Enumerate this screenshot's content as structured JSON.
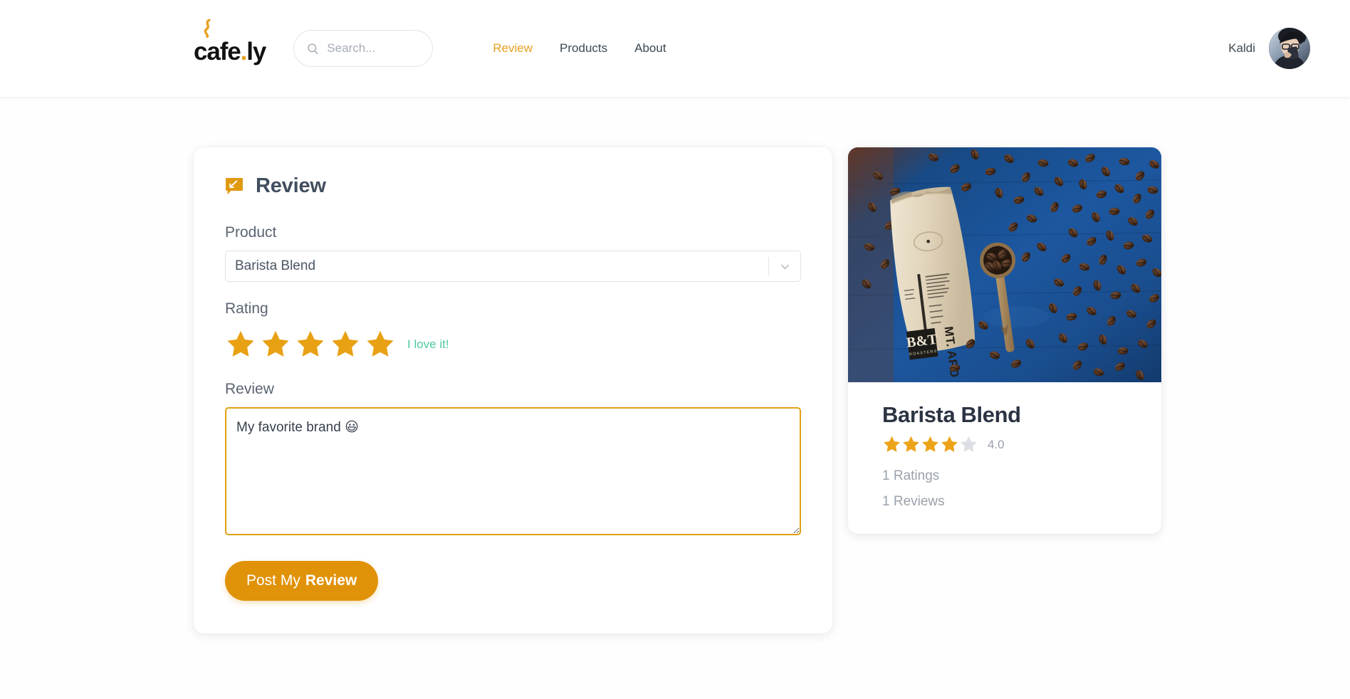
{
  "header": {
    "logo_text": "cafe",
    "logo_dot": ".",
    "logo_suffix": "ly",
    "logo_icon": "coffee-steam-swirl",
    "search": {
      "placeholder": "Search...",
      "value": "",
      "icon": "search-icon"
    },
    "nav": [
      {
        "label": "Review",
        "active": true
      },
      {
        "label": "Products",
        "active": false
      },
      {
        "label": "About",
        "active": false
      }
    ],
    "user": {
      "name": "Kaldi",
      "avatar_alt": "user-avatar-photo"
    }
  },
  "review_form": {
    "icon": "review-bubble-edit-icon",
    "title": "Review",
    "product": {
      "label": "Product",
      "selected": "Barista Blend",
      "options": [
        "Barista Blend"
      ],
      "arrow_icon": "chevron-down-icon"
    },
    "rating": {
      "label": "Rating",
      "value": 5,
      "max": 5,
      "caption": "I love it!",
      "caption_color": "#4dc99c",
      "star_color": "#e8a113"
    },
    "review": {
      "label": "Review",
      "value": "My favorite brand 😃",
      "placeholder": "",
      "focused": true,
      "border_color": "#e0a013"
    },
    "submit": {
      "label_regular": "Post My",
      "label_bold": "Review",
      "color": "#e09208"
    }
  },
  "product_card": {
    "image_alt": "coffee-bag-mt-apo-with-beans-on-blue-wood",
    "name": "Barista Blend",
    "rating_value": 4,
    "rating_max": 5,
    "score": "4.0",
    "ratings_count": "1 Ratings",
    "reviews_count": "1 Reviews"
  },
  "colors": {
    "accent": "#e8a020",
    "button": "#e09208",
    "star": "#e8a113",
    "star_empty": "#dcdfe4",
    "green": "#4dc99c",
    "text_dark": "#3d4852",
    "text_muted": "#9aa1ab",
    "page_bg": "#fefefe"
  }
}
